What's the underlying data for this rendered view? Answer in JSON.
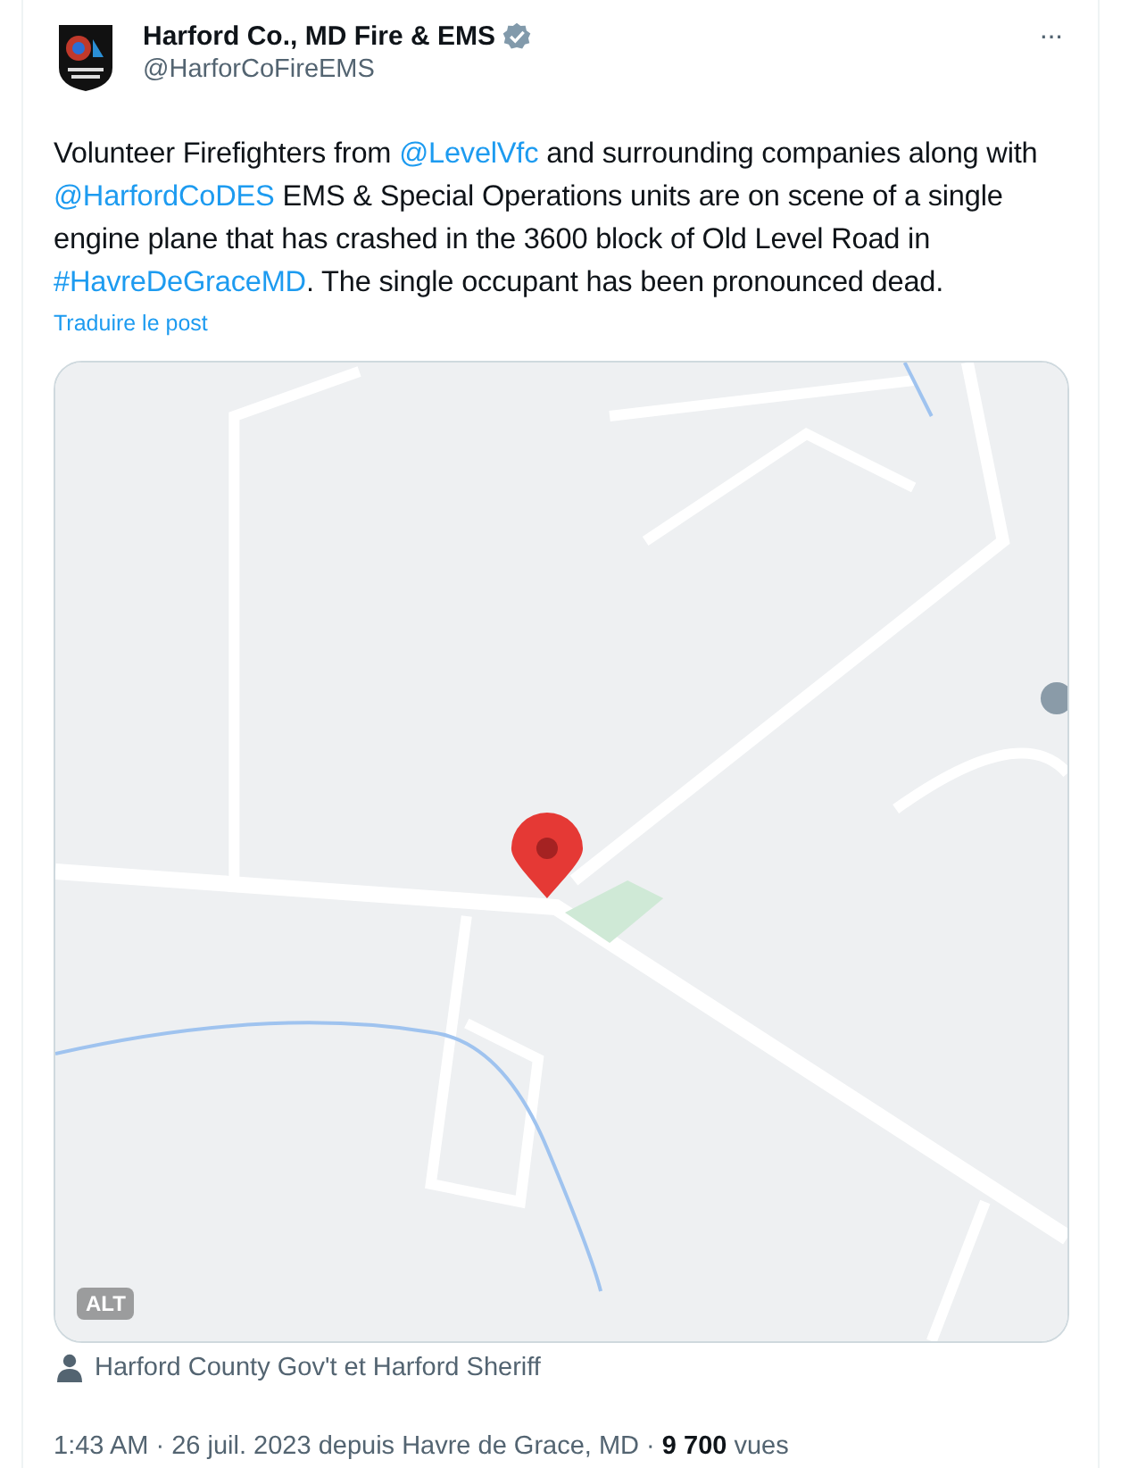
{
  "author": {
    "name": "Harford Co., MD Fire & EMS",
    "verified": true,
    "handle": "@HarforCoFireEMS"
  },
  "more": "···",
  "body": [
    {
      "kind": "text",
      "text": "Volunteer Firefighters from "
    },
    {
      "kind": "link",
      "text": "@LevelVfc"
    },
    {
      "kind": "text",
      "text": " and surrounding companies along with "
    },
    {
      "kind": "link",
      "text": "@HarfordCoDES"
    },
    {
      "kind": "text",
      "text": " EMS & Special Operations units are on scene of a single engine plane that has crashed in the 3600 block of Old Level Road in "
    },
    {
      "kind": "link",
      "text": "#HavreDeGraceMD"
    },
    {
      "kind": "text",
      "text": ". The single occupant has been pronounced dead."
    }
  ],
  "translate": "Traduire le post",
  "media": {
    "kind": "picture",
    "badge": "ALT"
  },
  "tagged": "Harford County Gov't et Harford Sheriff",
  "meta": "1:43 AM · 26 juil. 2023 depuis Havre de Grace, MD · **9 700** vues"
}
